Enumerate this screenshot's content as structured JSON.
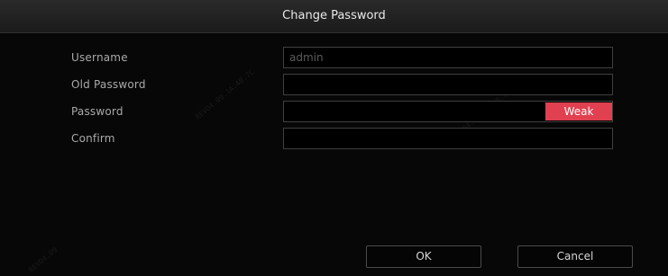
{
  "dialog": {
    "title": "Change Password"
  },
  "form": {
    "username_label": "Username",
    "username_value": "admin",
    "old_password_label": "Old Password",
    "old_password_value": "",
    "password_label": "Password",
    "password_value": "",
    "password_strength": "Weak",
    "confirm_label": "Confirm",
    "confirm_value": ""
  },
  "buttons": {
    "ok_label": "OK",
    "cancel_label": "Cancel"
  },
  "colors": {
    "strength_weak": "#e04050",
    "background": "#070707",
    "title_bar": "#222222"
  }
}
